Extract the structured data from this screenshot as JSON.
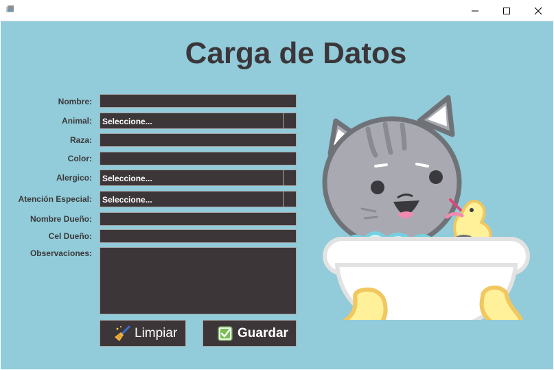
{
  "window": {
    "icon": "app-icon",
    "controls": {
      "minimize": "minimize-icon",
      "maximize": "maximize-icon",
      "close": "close-icon"
    }
  },
  "form": {
    "title": "Carga de Datos",
    "labels": {
      "nombre": "Nombre:",
      "animal": "Animal:",
      "raza": "Raza:",
      "color": "Color:",
      "alergico": "Alergico:",
      "atencion": "Atención Especial:",
      "nombre_dueno": "Nombre Dueño:",
      "cel_dueno": "Cel Dueño:",
      "observaciones": "Observaciones:"
    },
    "values": {
      "nombre": "",
      "raza": "",
      "color": "",
      "nombre_dueno": "",
      "cel_dueno": "",
      "observaciones": ""
    },
    "combos": {
      "animal": "Seleccione...",
      "alergico": "Seleccione...",
      "atencion": "Seleccione..."
    },
    "buttons": {
      "limpiar": "Limpiar",
      "guardar": "Guardar"
    }
  },
  "colors": {
    "background": "#92cbd9",
    "field": "#3c3639",
    "title": "#3a363a"
  },
  "illustration": "cat-in-bathtub-with-rubber-duck"
}
